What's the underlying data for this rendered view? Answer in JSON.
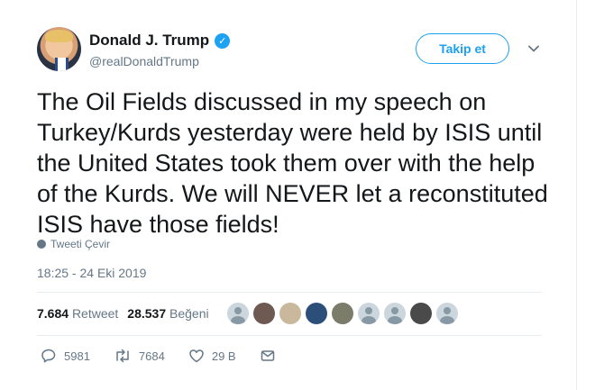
{
  "tweet": {
    "author_name": "Donald J. Trump",
    "author_handle": "@realDonaldTrump",
    "verified_glyph": "✓",
    "follow_label": "Takip et",
    "text": "The Oil Fields discussed in my speech on Turkey/Kurds yesterday were held by ISIS until the United States took them over with the help of the Kurds. We will NEVER let a reconstituted ISIS have those fields!",
    "translate_label": "Tweeti Çevir",
    "timestamp": "18:25 - 24 Eki 2019"
  },
  "stats": {
    "retweets_count": "7.684",
    "retweets_label": "Retweet",
    "likes_count": "28.537",
    "likes_label": "Beğeni"
  },
  "likers": [
    {
      "kind": "default"
    },
    {
      "kind": "photo",
      "color": "#6e5a52"
    },
    {
      "kind": "photo",
      "color": "#c9b89c"
    },
    {
      "kind": "photo",
      "color": "#2c4f7a"
    },
    {
      "kind": "photo",
      "color": "#7c7c6a"
    },
    {
      "kind": "default"
    },
    {
      "kind": "default"
    },
    {
      "kind": "photo",
      "color": "#4a4a4a"
    },
    {
      "kind": "default"
    }
  ],
  "actions": {
    "replies": "5981",
    "retweets": "7684",
    "likes": "29 B"
  },
  "colors": {
    "accent": "#1da1f2",
    "secondary_text": "#657786",
    "divider": "#e6ecf0"
  },
  "icons": [
    "verified-badge-icon",
    "chevron-down-icon",
    "globe-icon",
    "reply-icon",
    "retweet-icon",
    "like-icon",
    "direct-message-icon"
  ]
}
